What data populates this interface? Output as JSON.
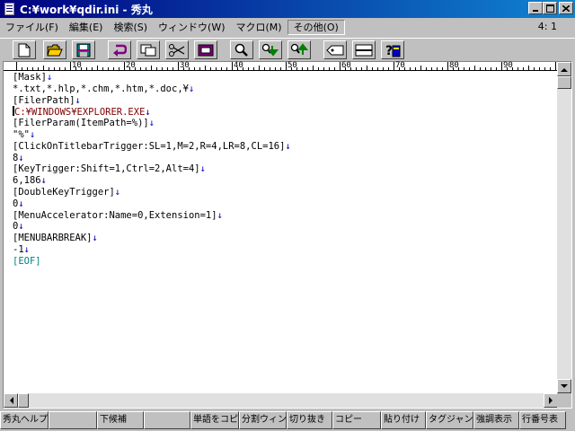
{
  "window": {
    "title": "C:¥work¥qdir.ini - 秀丸"
  },
  "menu": {
    "items": [
      "ファイル(F)",
      "編集(E)",
      "検索(S)",
      "ウィンドウ(W)",
      "マクロ(M)",
      "その他(O)"
    ],
    "position": "4: 1"
  },
  "toolbar": {
    "buttons": [
      "new-file",
      "open-folder",
      "save",
      "undo",
      "copy",
      "cut",
      "paste",
      "find",
      "find-down",
      "find-up",
      "tag-jump",
      "split-window",
      "help"
    ]
  },
  "ruler": {
    "labels": [
      "10",
      "20",
      "30",
      "40",
      "50",
      "60",
      "70",
      "80",
      "90"
    ]
  },
  "editor": {
    "lines": [
      "[Mask]",
      "*.txt,*.hlp,*.chm,*.htm,*.doc,¥",
      "[FilerPath]",
      "C:¥WINDOWS¥EXPLORER.EXE",
      "[FilerParam(ItemPath=%)]",
      "\"%\"",
      "[ClickOnTitlebarTrigger:SL=1,M=2,R=4,LR=8,CL=16]",
      "8",
      "[KeyTrigger:Shift=1,Ctrl=2,Alt=4]",
      "6,186",
      "[DoubleKeyTrigger]",
      "0",
      "[MenuAccelerator:Name=0,Extension=1]",
      "0",
      "[MENUBARBREAK]",
      "-1"
    ],
    "return_mark": "↓",
    "eof": "[EOF]"
  },
  "fkeys": [
    "秀丸ヘルプ",
    "",
    "下候補",
    "",
    "単語をコピ",
    "分割ウィント",
    "切り抜き",
    "コピー",
    "貼り付け",
    "タグジャンプ",
    "強調表示",
    "行番号表"
  ],
  "colors": {
    "title_start": "#000080",
    "title_end": "#1084d0",
    "return": "#0000c0",
    "path": "#800000",
    "eof": "#008080"
  }
}
